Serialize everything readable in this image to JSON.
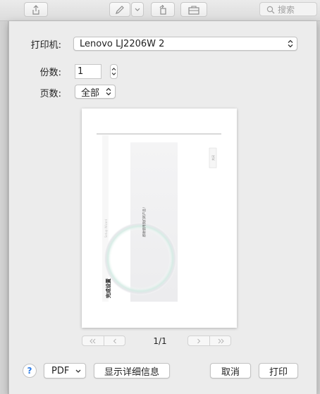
{
  "toolbar": {
    "search_placeholder": "搜索",
    "icons": [
      "share-icon",
      "pen-icon",
      "chevron-down-icon",
      "rotate-icon",
      "toolbox-icon",
      "search-icon"
    ]
  },
  "dialog": {
    "printer_label": "打印机:",
    "printer_value": "Lenovo LJ2206W 2",
    "copies_label": "份数:",
    "copies_value": "1",
    "pages_label": "页数:",
    "pages_value": "全部"
  },
  "preview": {
    "page_indicator": "1/1",
    "document": {
      "center_text": "感谢使用我们的产品！",
      "title_text": "完成设置",
      "side_text": "Setup Wizard",
      "tag_text": "关闭"
    }
  },
  "footer": {
    "help_label": "?",
    "pdf_label": "PDF",
    "details_label": "显示详细信息",
    "cancel_label": "取消",
    "print_label": "打印"
  },
  "colors": {
    "help_accent": "#2c7be5",
    "dialog_bg": "#ececec"
  }
}
